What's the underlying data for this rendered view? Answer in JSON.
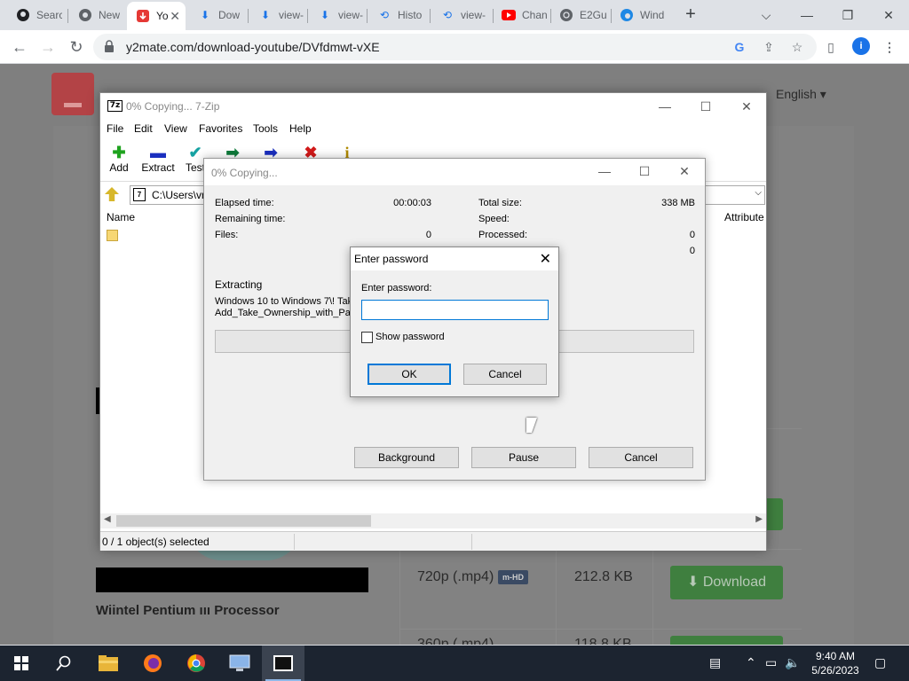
{
  "browser": {
    "tabs": [
      {
        "label": "Searc",
        "icon": "github-icon",
        "active": false
      },
      {
        "label": "New",
        "icon": "chrome-icon",
        "active": false
      },
      {
        "label": "Yo",
        "icon": "y2mate-icon",
        "active": true
      },
      {
        "label": "Dow",
        "icon": "download-icon",
        "active": false
      },
      {
        "label": "view-",
        "icon": "download-icon",
        "active": false
      },
      {
        "label": "view-",
        "icon": "download-icon",
        "active": false
      },
      {
        "label": "Histo",
        "icon": "history-icon",
        "active": false
      },
      {
        "label": "view-",
        "icon": "history-icon",
        "active": false
      },
      {
        "label": "Chan",
        "icon": "youtube-icon",
        "active": false
      },
      {
        "label": "E2Gu",
        "icon": "globe-icon",
        "active": false
      },
      {
        "label": "Wind",
        "icon": "edge-icon",
        "active": false
      }
    ],
    "url": "y2mate.com/download-youtube/DVfdmwt-vXE",
    "profile_initial": "i"
  },
  "page": {
    "language": "English",
    "product_title": "Wiintel Pentium ııı Processor",
    "rows": [
      {
        "quality": "720p (.mp4)",
        "badge": "m-HD",
        "size": "212.8 KB",
        "action": "Download"
      },
      {
        "quality": "360p (.mp4)",
        "size": "118.8 KB"
      }
    ]
  },
  "sevenzip": {
    "title": "0% Copying... 7-Zip",
    "app_icon_text": "7z",
    "menu": [
      "File",
      "Edit",
      "View",
      "Favorites",
      "Tools",
      "Help"
    ],
    "toolbar": [
      {
        "label": "Add",
        "icon": "add-icon"
      },
      {
        "label": "Extract",
        "icon": "extract-icon"
      },
      {
        "label": "Test",
        "icon": "test-icon"
      },
      {
        "label": "",
        "icon": "copy-icon"
      },
      {
        "label": "",
        "icon": "move-icon"
      },
      {
        "label": "",
        "icon": "delete-icon"
      },
      {
        "label": "",
        "icon": "info-icon"
      }
    ],
    "path": "C:\\Users\\vn",
    "columns": {
      "name": "Name",
      "attributes": "Attribute"
    },
    "status": "0 / 1 object(s) selected"
  },
  "copy_dialog": {
    "title": "0% Copying...",
    "elapsed_label": "Elapsed time:",
    "elapsed_value": "00:00:03",
    "remaining_label": "Remaining time:",
    "files_label": "Files:",
    "files_value": "0",
    "total_label": "Total size:",
    "total_value": "338 MB",
    "speed_label": "Speed:",
    "processed_label": "Processed:",
    "processed_value": "0",
    "extra_value": "0",
    "extracting_label": "Extracting",
    "extracting_line1": "Windows 10 to Windows 7\\! Tak",
    "extracting_line2": "Add_Take_Ownership_with_Pau",
    "progress": 0,
    "buttons": {
      "background": "Background",
      "pause": "Pause",
      "cancel": "Cancel"
    }
  },
  "password_dialog": {
    "title": "Enter password",
    "label": "Enter password:",
    "value": "",
    "show_password": "Show password",
    "show_password_checked": false,
    "ok": "OK",
    "cancel": "Cancel"
  },
  "taskbar": {
    "time": "9:40 AM",
    "date": "5/26/2023",
    "apps": [
      "start-icon",
      "search-icon",
      "file-explorer-icon",
      "firefox-icon",
      "chrome-icon",
      "remote-desktop-icon",
      "sevenzip-icon"
    ]
  }
}
